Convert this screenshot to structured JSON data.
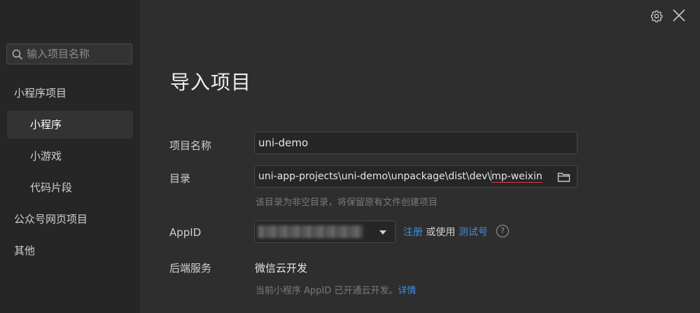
{
  "sidebar": {
    "search_placeholder": "输入项目名称",
    "groups": [
      {
        "label": "小程序项目"
      },
      {
        "label": "小程序"
      },
      {
        "label": "小游戏"
      },
      {
        "label": "代码片段"
      },
      {
        "label": "公众号网页项目"
      },
      {
        "label": "其他"
      }
    ]
  },
  "header": {
    "settings_icon": "gear-icon",
    "close_icon": "close-icon"
  },
  "main": {
    "title": "导入项目",
    "project_name_label": "项目名称",
    "project_name_value": "uni-demo",
    "directory_label": "目录",
    "directory_value_prefix": "uni-app-projects\\uni-demo\\unpackage\\dist\\dev\\",
    "directory_value_suffix": "mp-weixin",
    "directory_hint": "该目录为非空目录，将保留原有文件创建项目",
    "appid_label": "AppID",
    "register_link": "注册",
    "or_use": "或使用",
    "test_account_link": "测试号",
    "help_icon": "?",
    "backend_label": "后端服务",
    "backend_value": "微信云开发",
    "backend_hint": "当前小程序 AppID 已开通云开发。",
    "details_link": "详情"
  },
  "colors": {
    "background": "#2e2e2e",
    "sidebar": "#262626",
    "link": "#3f8fe0",
    "underline_error": "#d83a3a",
    "cursor": "#2db35d"
  }
}
